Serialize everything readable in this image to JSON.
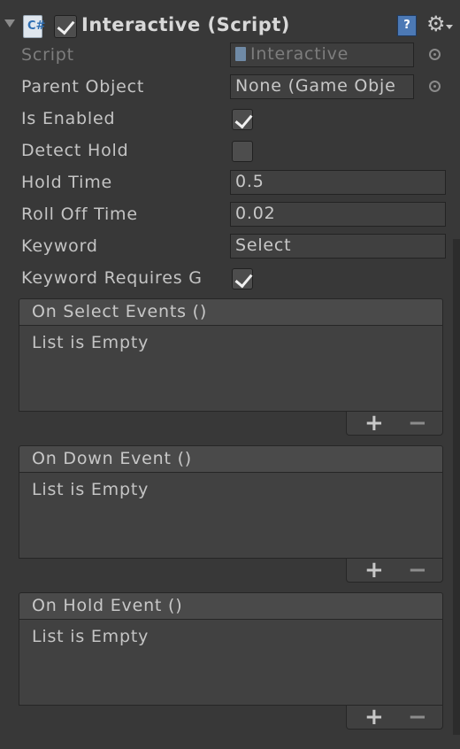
{
  "component": {
    "title": "Interactive (Script)",
    "enabled": true,
    "script_icon_glyph": "C#",
    "help_glyph": "?",
    "gear_glyph": "⚙"
  },
  "fields": {
    "script": {
      "label": "Script",
      "value": "Interactive"
    },
    "parent_object": {
      "label": "Parent Object",
      "value": "None (Game Obje"
    },
    "is_enabled": {
      "label": "Is Enabled",
      "checked": true
    },
    "detect_hold": {
      "label": "Detect Hold",
      "checked": false
    },
    "hold_time": {
      "label": "Hold Time",
      "value": "0.5"
    },
    "roll_off_time": {
      "label": "Roll Off Time",
      "value": "0.02"
    },
    "keyword": {
      "label": "Keyword",
      "value": "Select"
    },
    "keyword_requires_gaze": {
      "label": "Keyword Requires G",
      "checked": true
    }
  },
  "events": [
    {
      "title": "On Select Events ()",
      "empty_text": "List is Empty",
      "add": "+",
      "remove": "−"
    },
    {
      "title": "On Down Event ()",
      "empty_text": "List is Empty",
      "add": "+",
      "remove": "−"
    },
    {
      "title": "On Hold Event ()",
      "empty_text": "List is Empty",
      "add": "+",
      "remove": "−"
    }
  ],
  "colors": {
    "background": "#383838",
    "text": "#c4c4c4",
    "disabled_text": "#7d7d7d",
    "help_icon": "#4c79b5"
  }
}
